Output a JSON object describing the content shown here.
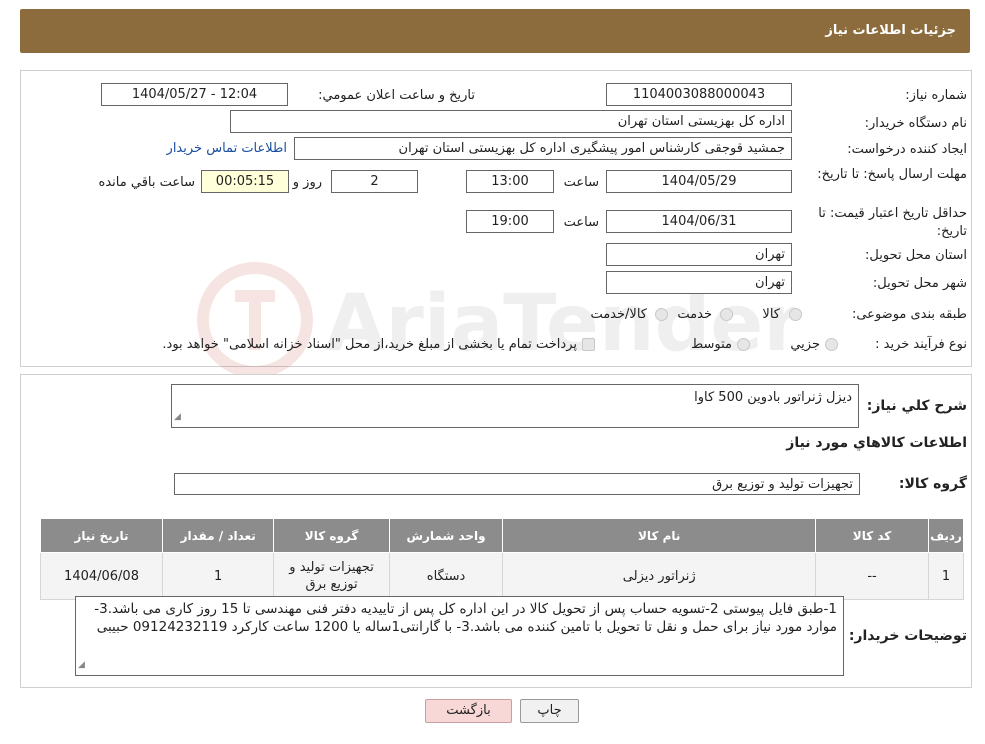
{
  "header": {
    "title": "جزئیات اطلاعات نیاز"
  },
  "need_number": {
    "label": "شماره نیاز:",
    "value": "1104003088000043"
  },
  "announce_datetime": {
    "label": "تاريخ و ساعت اعلان عمومي:",
    "value": "1404/05/27 - 12:04"
  },
  "buyer_org": {
    "label": "نام دستگاه خريدار:",
    "value": "اداره کل بهزیستی استان تهران"
  },
  "requester": {
    "label": "ايجاد کننده درخواست:",
    "value": "جمشید قوجقی کارشناس امور پیشگیری اداره کل بهزیستی استان تهران",
    "contact_link": "اطلاعات تماس خريدار"
  },
  "reply_deadline": {
    "label": "مهلت ارسال پاسخ: تا تاریخ:",
    "date": "1404/05/29",
    "time_label": "ساعت",
    "time": "13:00",
    "days": "2",
    "days_label": "روز و",
    "remaining": "00:05:15",
    "remaining_label": "ساعت باقي مانده"
  },
  "price_validity": {
    "label": "حداقل تاريخ اعتبار قيمت: تا تاریخ:",
    "date": "1404/06/31",
    "time_label": "ساعت",
    "time": "19:00"
  },
  "province": {
    "label": "استان محل تحويل:",
    "value": "تهران"
  },
  "city": {
    "label": "شهر محل تحويل:",
    "value": "تهران"
  },
  "category": {
    "label": "طبقه بندی موضوعی:",
    "options": [
      "کالا",
      "خدمت",
      "کالا/خدمت"
    ]
  },
  "process": {
    "label": "نوع فرآيند خريد :",
    "options": [
      "جزيي",
      "متوسط"
    ],
    "note": "پرداخت تمام یا بخشی از مبلغ خرید،از محل \"اسناد خزانه اسلامی\" خواهد بود."
  },
  "summary": {
    "label": "شرح کلي نياز:",
    "value": "دیزل ژنراتور بادوین 500 کاوا"
  },
  "items_title": "اطلاعات کالاهاي مورد نياز",
  "goods_group": {
    "label": "گروه کالا:",
    "value": "تجهیزات تولید و توزیع برق"
  },
  "table": {
    "headers": [
      "رديف",
      "کد کالا",
      "نام کالا",
      "واحد شمارش",
      "گروه کالا",
      "تعداد / مقدار",
      "تاريخ نياز"
    ],
    "rows": [
      [
        "1",
        "--",
        "ژنراتور دیزلی",
        "دستگاه",
        "تجهیزات تولید و توزیع برق",
        "1",
        "1404/06/08"
      ]
    ]
  },
  "buyer_notes": {
    "label": "توضيحات خريدار:",
    "value": "1-طبق فایل پیوستی 2-تسویه حساب پس از تحویل کالا در این اداره کل پس از تاییدیه دفتر فنی مهندسی  تا 15 روز کاری می باشد.3- موارد مورد نیاز برای حمل و نقل تا تحویل با تامین کننده می باشد.3- با گارانتی1ساله یا 1200 ساعت کارکرد 09124232119 حبیبی"
  },
  "buttons": {
    "print": "چاپ",
    "back": "بازگشت"
  },
  "watermark": "AriaTender.neT"
}
